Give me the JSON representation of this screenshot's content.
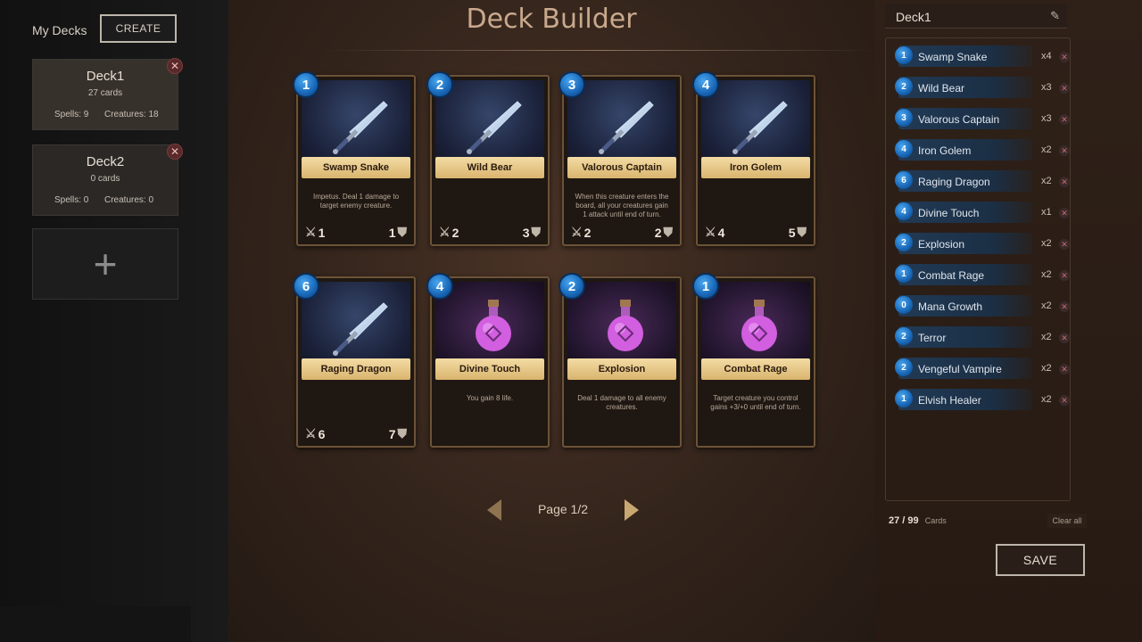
{
  "sidebar": {
    "title": "My Decks",
    "create_label": "CREATE",
    "add_label": "+",
    "decks": [
      {
        "name": "Deck1",
        "count": "27 cards",
        "spells": "Spells: 9",
        "creatures": "Creatures: 18",
        "delete": "✕"
      },
      {
        "name": "Deck2",
        "count": "0 cards",
        "spells": "Spells: 0",
        "creatures": "Creatures: 0",
        "delete": "✕"
      }
    ]
  },
  "main": {
    "title": "Deck Builder",
    "pager": {
      "label": "Page 1/2"
    },
    "cards": [
      {
        "cost": "1",
        "name": "Swamp Snake",
        "desc": "Impetus. Deal 1 damage to target enemy creature.",
        "atk": "1",
        "def": "1",
        "kind": "creature"
      },
      {
        "cost": "2",
        "name": "Wild Bear",
        "desc": "",
        "atk": "2",
        "def": "3",
        "kind": "creature"
      },
      {
        "cost": "3",
        "name": "Valorous Captain",
        "desc": "When this creature enters the board, all your creatures gain 1 attack until end of turn.",
        "atk": "2",
        "def": "2",
        "kind": "creature"
      },
      {
        "cost": "4",
        "name": "Iron Golem",
        "desc": "",
        "atk": "4",
        "def": "5",
        "kind": "creature"
      },
      {
        "cost": "6",
        "name": "Raging Dragon",
        "desc": "",
        "atk": "6",
        "def": "7",
        "kind": "creature"
      },
      {
        "cost": "4",
        "name": "Divine Touch",
        "desc": "You gain 8 life.",
        "atk": "",
        "def": "",
        "kind": "spell"
      },
      {
        "cost": "2",
        "name": "Explosion",
        "desc": "Deal 1 damage to all enemy creatures.",
        "atk": "",
        "def": "",
        "kind": "spell"
      },
      {
        "cost": "1",
        "name": "Combat Rage",
        "desc": "Target creature you control gains +3/+0 until end of turn.",
        "atk": "",
        "def": "",
        "kind": "spell"
      }
    ]
  },
  "deck_panel": {
    "name": "Deck1",
    "rows": [
      {
        "cost": "1",
        "name": "Swamp Snake",
        "qty": "x4"
      },
      {
        "cost": "2",
        "name": "Wild Bear",
        "qty": "x3"
      },
      {
        "cost": "3",
        "name": "Valorous Captain",
        "qty": "x3"
      },
      {
        "cost": "4",
        "name": "Iron Golem",
        "qty": "x2"
      },
      {
        "cost": "6",
        "name": "Raging Dragon",
        "qty": "x2"
      },
      {
        "cost": "4",
        "name": "Divine Touch",
        "qty": "x1"
      },
      {
        "cost": "2",
        "name": "Explosion",
        "qty": "x2"
      },
      {
        "cost": "1",
        "name": "Combat Rage",
        "qty": "x2"
      },
      {
        "cost": "0",
        "name": "Mana Growth",
        "qty": "x2"
      },
      {
        "cost": "2",
        "name": "Terror",
        "qty": "x2"
      },
      {
        "cost": "2",
        "name": "Vengeful Vampire",
        "qty": "x2"
      },
      {
        "cost": "1",
        "name": "Elvish Healer",
        "qty": "x2"
      }
    ],
    "totals_num": "27 / 99",
    "totals_unit": "Cards",
    "clear_label": "Clear all",
    "save_label": "SAVE"
  }
}
